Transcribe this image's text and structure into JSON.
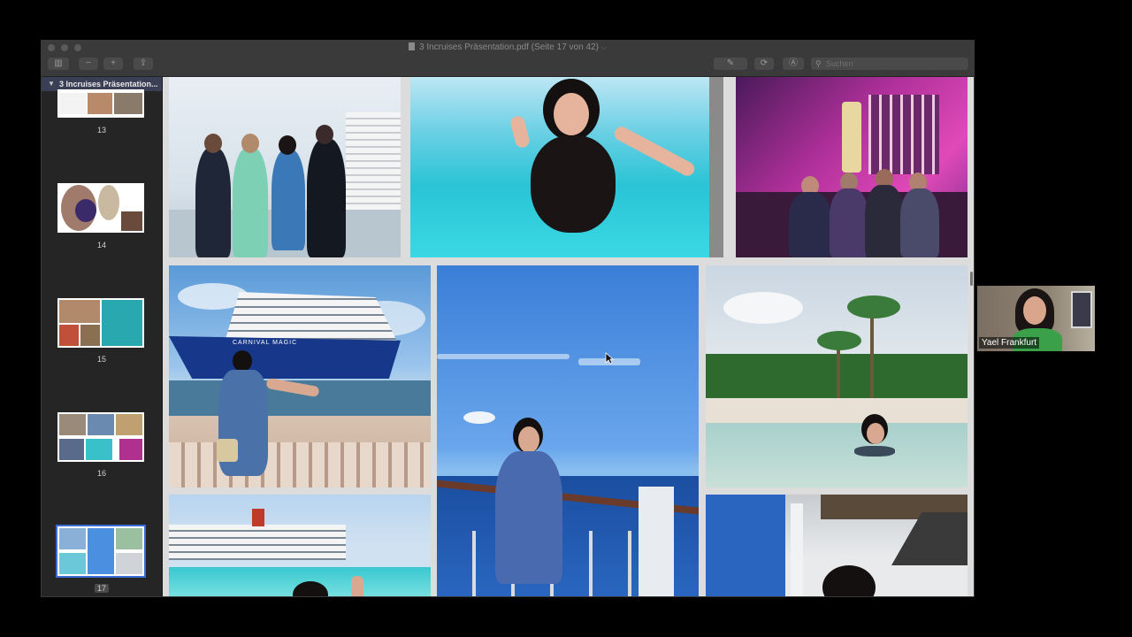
{
  "window": {
    "title": "3 Incruises Präsentation.pdf (Seite 17 von 42)",
    "search_placeholder": "Suchen",
    "toolbar": {
      "sidebar_toggle": "▥",
      "zoom_out": "−",
      "zoom_in": "+",
      "share": "⇪",
      "markup": "✎",
      "rotate": "⟳",
      "annotate": "Ⓐ"
    }
  },
  "sidebar": {
    "document_name": "3 Incruises Präsentation...",
    "pages": [
      {
        "number": "13"
      },
      {
        "number": "14"
      },
      {
        "number": "15"
      },
      {
        "number": "16"
      },
      {
        "number": "17",
        "selected": true
      }
    ]
  },
  "page": {
    "ship_name": "CARNIVAL MAGIC"
  },
  "video_call": {
    "participant": "Yael Frankfurt"
  },
  "colors": {
    "window_bg": "#2b2b2b",
    "titlebar": "#3a3a3a",
    "sidebar_header": "#3b3f55",
    "sky": "#4a8fe0",
    "pool": "#29c4d4",
    "lounge": "#b0309a"
  }
}
